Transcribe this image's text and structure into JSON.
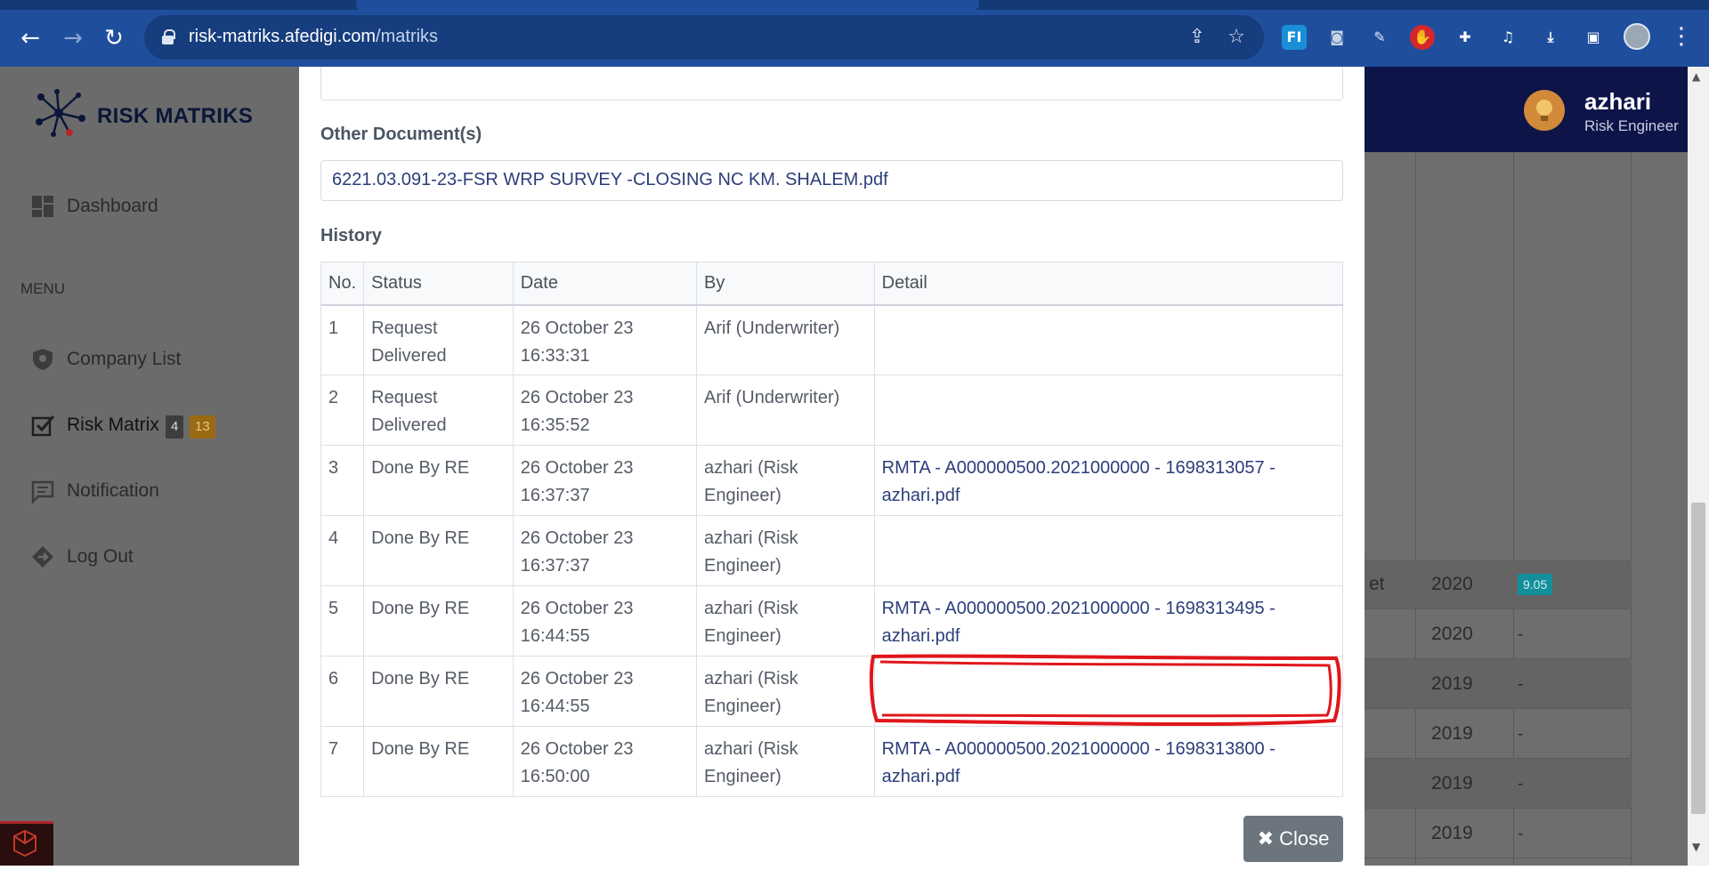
{
  "browser": {
    "url_host": "risk-matriks.afedigi.com",
    "url_path": "/matriks",
    "nav": {
      "back": "←",
      "forward": "→",
      "reload": "↻"
    },
    "icons": [
      "share-icon",
      "star-icon",
      "extension-fi-icon",
      "camera-icon",
      "extension-icon",
      "stop-hand-icon",
      "puzzle-icon",
      "media-icon",
      "download-icon",
      "sidepanel-icon",
      "profile-icon",
      "menu-icon"
    ],
    "ext_label": "FI"
  },
  "sidebar": {
    "brand": "RISK MATRIKS",
    "dashboard": "Dashboard",
    "menu_heading": "MENU",
    "items": [
      {
        "label": "Company List",
        "icon": "shield-icon"
      },
      {
        "label": "Risk Matrix",
        "icon": "checkbox-icon",
        "badges": [
          "4",
          "13"
        ]
      },
      {
        "label": "Notification",
        "icon": "message-icon"
      },
      {
        "label": "Log Out",
        "icon": "logout-icon"
      }
    ]
  },
  "user": {
    "name": "azhari",
    "role": "Risk Engineer"
  },
  "background_table": {
    "rows": [
      {
        "cell": "et",
        "year": "2020",
        "value": "9.05"
      },
      {
        "cell": "",
        "year": "2020",
        "value": "-"
      },
      {
        "cell": "",
        "year": "2019",
        "value": "-"
      },
      {
        "cell": "",
        "year": "2019",
        "value": "-"
      },
      {
        "cell": "",
        "year": "2019",
        "value": "-"
      },
      {
        "cell": "",
        "year": "2019",
        "value": "-"
      }
    ]
  },
  "modal": {
    "other_docs_label": "Other Document(s)",
    "other_doc_value": "6221.03.091-23-FSR WRP SURVEY -CLOSING NC KM. SHALEM.pdf",
    "history_label": "History",
    "columns": [
      "No.",
      "Status",
      "Date",
      "By",
      "Detail"
    ],
    "rows": [
      {
        "no": "1",
        "status": "Request Delivered",
        "date": "26 October 23 16:33:31",
        "by": "Arif (Underwriter)",
        "detail": ""
      },
      {
        "no": "2",
        "status": "Request Delivered",
        "date": "26 October 23 16:35:52",
        "by": "Arif (Underwriter)",
        "detail": ""
      },
      {
        "no": "3",
        "status": "Done By RE",
        "date": "26 October 23 16:37:37",
        "by": "azhari (Risk Engineer)",
        "detail": "RMTA - A000000500.2021000000 - 1698313057 - azhari.pdf"
      },
      {
        "no": "4",
        "status": "Done By RE",
        "date": "26 October 23 16:37:37",
        "by": "azhari (Risk Engineer)",
        "detail": ""
      },
      {
        "no": "5",
        "status": "Done By RE",
        "date": "26 October 23 16:44:55",
        "by": "azhari (Risk Engineer)",
        "detail": "RMTA - A000000500.2021000000 - 1698313495 - azhari.pdf"
      },
      {
        "no": "6",
        "status": "Done By RE",
        "date": "26 October 23 16:44:55",
        "by": "azhari (Risk Engineer)",
        "detail": ""
      },
      {
        "no": "7",
        "status": "Done By RE",
        "date": "26 October 23 16:50:00",
        "by": "azhari (Risk Engineer)",
        "detail": "RMTA - A000000500.2021000000 - 1698313800 - azhari.pdf"
      }
    ],
    "close_label": "Close",
    "close_icon": "✖"
  },
  "colors": {
    "chrome": "#1f4f9c",
    "topbar": "#0c1448",
    "annotation": "#e0161b",
    "close_button": "#6c757d"
  }
}
